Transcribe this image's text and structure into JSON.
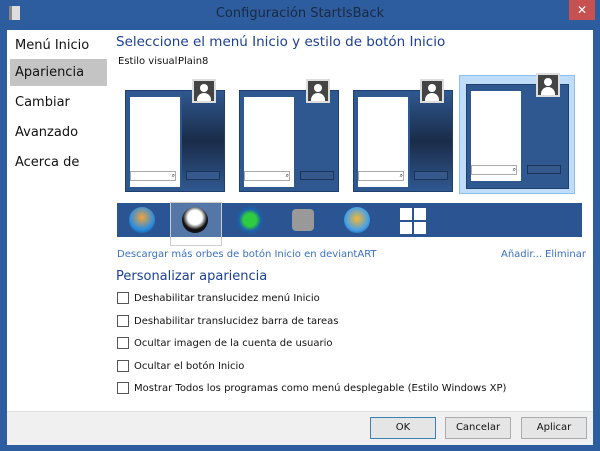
{
  "window": {
    "title": "Configuración StartIsBack",
    "close": "✕"
  },
  "sidebar": {
    "items": [
      {
        "label": "Menú Inicio"
      },
      {
        "label": "Apariencia",
        "selected": true
      },
      {
        "label": "Cambiar"
      },
      {
        "label": "Avanzado"
      },
      {
        "label": "Acerca de"
      }
    ]
  },
  "main": {
    "heading": "Seleccione el menú Inicio y estilo de botón Inicio",
    "visual_style_label": "Estilo visual:",
    "visual_style_value": "Plain8",
    "menu_styles_selected_index": 3,
    "orbs": [
      "windows7-orb",
      "punisher-skull-orb",
      "shamrock-orb",
      "grey-windows-orb",
      "windows-color-orb",
      "windows8-logo-orb"
    ],
    "orb_selected_index": 1,
    "download_link": "Descargar más orbes de botón Inicio en deviantART",
    "add_link": "Añadir...",
    "remove_link": "Eliminar",
    "customize_heading": "Personalizar apariencia",
    "options": [
      {
        "label": "Deshabilitar translucidez menú Inicio",
        "checked": false
      },
      {
        "label": "Deshabilitar translucidez barra de tareas",
        "checked": false
      },
      {
        "label": "Ocultar imagen de la cuenta de usuario",
        "checked": false
      },
      {
        "label": "Ocultar el botón Inicio",
        "checked": false
      },
      {
        "label": "Mostrar Todos los programas como menú desplegable (Estilo Windows XP)",
        "checked": false
      }
    ]
  },
  "footer": {
    "ok": "OK",
    "cancel": "Cancelar",
    "apply": "Aplicar"
  }
}
